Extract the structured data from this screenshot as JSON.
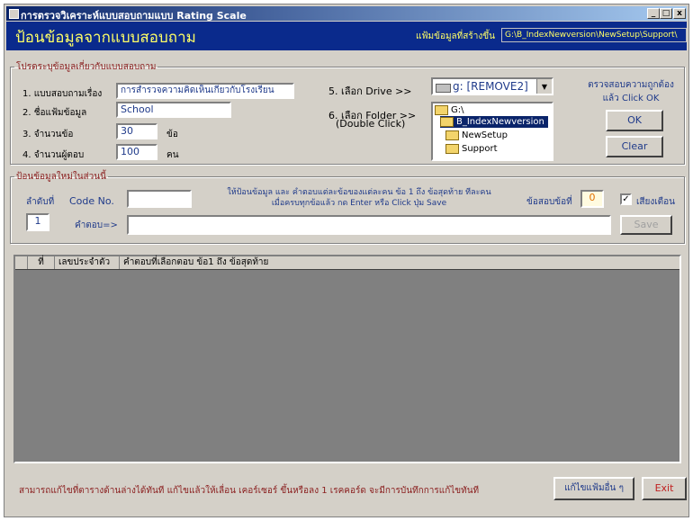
{
  "window": {
    "title": "การตรวจวิเคราะห์แบบสอบถามแบบ Rating Scale",
    "minimize": "_",
    "maximize": "□",
    "close": "x"
  },
  "header": {
    "title": "ป้อนข้อมูลจากแบบสอบถาม",
    "path_label": "แฟ้มข้อมูลที่สร้างขึ้น",
    "path_value": "G:\\B_IndexNewversion\\NewSetup\\Support\\"
  },
  "survey_group": {
    "legend": "โปรดระบุข้อมูลเกี่ยวกับแบบสอบถาม",
    "fields": [
      {
        "label": "1. แบบสอบถามเรื่อง",
        "value": "การสำรวจความคิดเห็นเกี่ยวกับโรงเรียน",
        "unit": ""
      },
      {
        "label": "2. ชื่อแฟ้มข้อมูล",
        "value": "School",
        "unit": ""
      },
      {
        "label": "3. จำนวนข้อ",
        "value": "30",
        "unit": "ข้อ"
      },
      {
        "label": "4. จำนวนผู้ตอบ",
        "value": "100",
        "unit": "คน"
      }
    ],
    "drive_label": "5. เลือก Drive  >>",
    "drive_value": "g: [REMOVE2]",
    "folder_label": "6. เลือก Folder >>",
    "folder_hint": "(Double Click)",
    "folders": [
      "G:\\",
      "B_IndexNewversion",
      "NewSetup",
      "Support"
    ],
    "check_hint": "ตรวจสอบความถูกต้อง\nแล้ว Click OK",
    "ok_button": "OK",
    "clear_button": "Clear"
  },
  "entry_group": {
    "legend": "ป้อนข้อมูลใหม่ในส่วนนี้",
    "order_label": "ลำดับที่",
    "order_value": "1",
    "code_label": "Code No.",
    "code_value": "",
    "instructions": "ให้ป้อนข้อมูล และ คำตอบแต่ละข้อของแต่ละคน ข้อ 1 ถึง ข้อสุดท้าย ทีละคน\nเมื่อครบทุกข้อแล้ว กด Enter หรือ Click ปุ่ม Save",
    "current_item_label": "ข้อสอบข้อที่",
    "current_item_value": "0",
    "sound_label": "เสียงเตือน",
    "sound_checked": true,
    "answer_label": "คำตอบ=>",
    "answer_value": "",
    "save_button": "Save"
  },
  "grid": {
    "columns": [
      "ที่",
      "เลขประจำตัว",
      "คำตอบที่เลือกตอบ ข้อ1 ถึง ข้อสุดท้าย"
    ],
    "rows": []
  },
  "footer": {
    "note": "สามารถแก้ไขที่ตารางด้านล่างได้ทันที แก้ไขแล้วให้เลื่อน เคอร์เซอร์ ขึ้นหรือลง 1 เรคคอร์ด จะมีการบันทึกการแก้ไขทันที",
    "edit_other_button": "แก้ไขแฟ้มอื่น ๆ",
    "exit_button": "Exit"
  },
  "colors": {
    "header_bg": "#0a2a8c",
    "header_text": "#ffff66",
    "label_blue": "#1f3a8a",
    "note_text": "#8b2020",
    "current_item_text": "#e07000"
  }
}
